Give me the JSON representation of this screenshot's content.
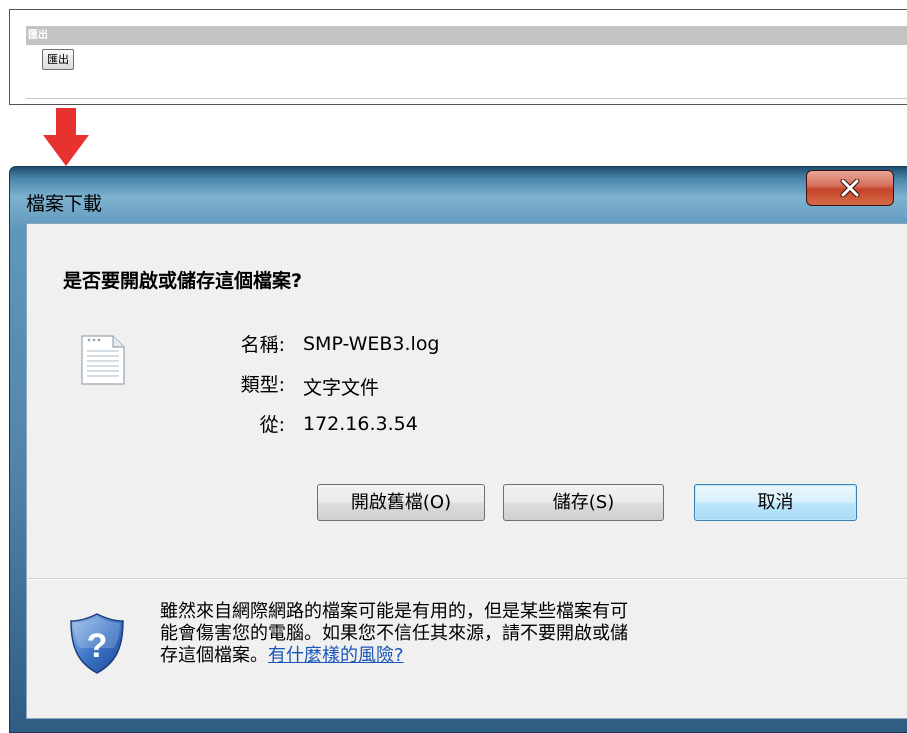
{
  "export_panel": {
    "header_label": "匯出",
    "button_label": "匯出"
  },
  "dialog": {
    "title": "檔案下載",
    "heading": "是否要開啟或儲存這個檔案?",
    "fields": [
      {
        "label": "名稱:",
        "value": "SMP-WEB3.log"
      },
      {
        "label": "類型:",
        "value": "文字文件"
      },
      {
        "label": "從:",
        "value": "172.16.3.54"
      }
    ],
    "buttons": {
      "open": "開啟舊檔(O)",
      "save": "儲存(S)",
      "cancel": "取消"
    },
    "warning_line1": "雖然來自網際網路的檔案可能是有用的，但是某些檔案有可",
    "warning_line2": "能會傷害您的電腦。如果您不信任其來源，請不要開啟或儲",
    "warning_line3": "存這個檔案。",
    "risk_link": "有什麼樣的風險?"
  },
  "colors": {
    "arrow": "#e8322f",
    "link": "#1a55b7",
    "title_bar": "#5f97bc",
    "close_button": "#c5432a"
  }
}
